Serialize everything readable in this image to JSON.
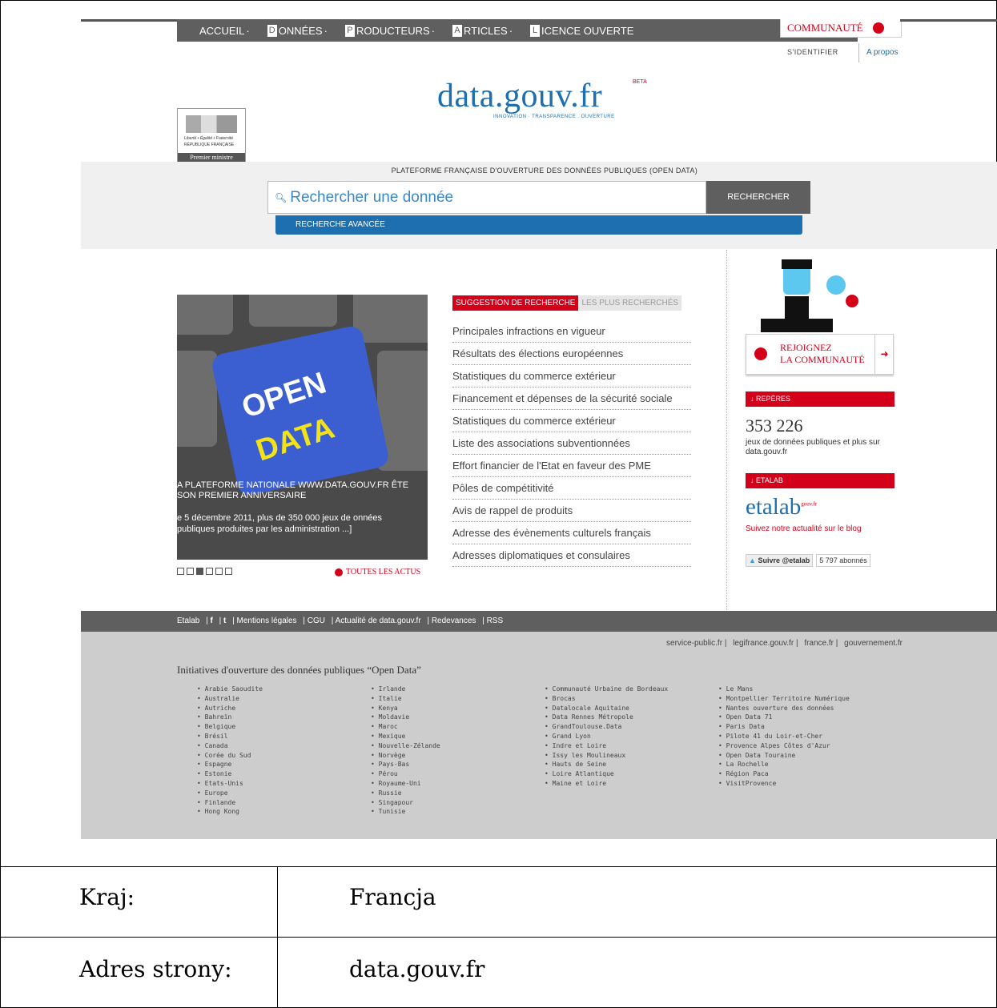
{
  "nav": {
    "items": [
      {
        "letter": "",
        "label": "ACCUEIL"
      },
      {
        "letter": "D",
        "label": "ONNÉES"
      },
      {
        "letter": "P",
        "label": "RODUCTEURS"
      },
      {
        "letter": "A",
        "label": "RTICLES"
      },
      {
        "letter": "L",
        "label": "ICENCE OUVERTE"
      }
    ],
    "community": "COMMUNAUTÉ",
    "login": "S'IDENTIFIER",
    "about": "A propos"
  },
  "header": {
    "logo": "data.gouv.fr",
    "beta": "BETA",
    "tagline": "INNOVATION · TRANSPARENCE . OUVERTURE",
    "rf_motto": "Liberté • Égalité • Fraternité",
    "rf_name": "RÉPUBLIQUE FRANÇAISE",
    "rf_ministry": "Premier ministre"
  },
  "search": {
    "platform": "PLATEFORME FRANÇAISE D'OUVERTURE DES DONNÉES PUBLIQUES (OPEN DATA)",
    "placeholder": "Rechercher une donnée",
    "button": "RECHERCHER",
    "advanced": "RECHERCHE AVANCÉE"
  },
  "carousel": {
    "open": "OPEN",
    "data": "DATA",
    "caption": "A PLATEFORME NATIONALE WWW.DATA.GOUV.FR ÊTE SON PREMIER ANNIVERSAIRE",
    "description": "e 5 décembre 2011, plus de 350 000 jeux de onnées publiques produites par les administration ...]",
    "all_news": "TOUTES LES ACTUS"
  },
  "suggestions": {
    "tab_active": "SUGGESTION DE RECHERCHE",
    "tab_inactive": "LES PLUS RECHERCHÉS",
    "items": [
      "Principales infractions en vigueur",
      "Résultats des élections européennes",
      "Statistiques du commerce extérieur",
      "Financement et dépenses de la sécurité sociale",
      "Statistiques du commerce extérieur",
      "Liste des associations subventionnées",
      "Effort financier de l'Etat en faveur des PME",
      "Pôles de compétitivité",
      "Avis de rappel de produits",
      "Adresse des évènements culturels français",
      "Adresses diplomatiques et consulaires"
    ]
  },
  "sidebar": {
    "join_line1": "REJOIGNEZ",
    "join_line2": "LA COMMUNAUTÉ",
    "reperes": "REPÈRES",
    "count": "353 226",
    "count_text": "jeux de données publiques et plus sur data.gouv.fr",
    "etalab_title": "ETALAB",
    "etalab_logo": "etalab",
    "etalab_sup": "gouv.fr",
    "blog": "Suivez notre actualité sur le blog",
    "follow": "Suivre @etalab",
    "followers": "5 797 abonnés"
  },
  "footer": {
    "links": [
      "Etalab",
      "f",
      "t",
      "Mentions légales",
      "CGU",
      "Actualité de data.gouv.fr",
      "Redevances",
      "RSS"
    ],
    "gov_links": [
      "service-public.fr",
      "legifrance.gouv.fr",
      "france.fr",
      "gouvernement.fr"
    ],
    "initiatives_title": "Initiatives d'ouverture des données publiques “Open Data”",
    "columns": [
      [
        "Arabie Saoudite",
        "Australie",
        "Autriche",
        "Bahreïn",
        "Belgique",
        "Brésil",
        "Canada",
        "Corée du Sud",
        "Espagne",
        "Estonie",
        "Etats-Unis",
        "Europe",
        "Finlande",
        "Hong Kong"
      ],
      [
        "Irlande",
        "Italie",
        "Kenya",
        "Moldavie",
        "Maroc",
        "Mexique",
        "Nouvelle-Zélande",
        "Norvège",
        "Pays-Bas",
        "Pérou",
        "Royaume-Uni",
        "Russie",
        "Singapour",
        "Tunisie"
      ],
      [
        "Communauté Urbaine de Bordeaux",
        "Brocas",
        "Datalocale Aquitaine",
        "Data Rennes Métropole",
        "GrandToulouse.Data",
        "Grand Lyon",
        "Indre et Loire",
        "Issy les Moulineaux",
        "Hauts de Seine",
        "Loire Atlantique",
        "Maine et Loire"
      ],
      [
        "Le Mans",
        "Montpellier Territoire Numérique",
        "Nantes ouverture des données",
        "Open Data 71",
        "Paris Data",
        "Pilote 41 du Loir-et-Cher",
        "Provence Alpes Côtes d'Azur",
        "Open Data Touraine",
        "La Rochelle",
        "Région Paca",
        "VisitProvence"
      ]
    ]
  },
  "table": {
    "country_label": "Kraj:",
    "country_value": "Francja",
    "address_label": "Adres strony:",
    "address_value": "data.gouv.fr"
  },
  "colors": {
    "red": "#d4001a",
    "blue": "#1d6fb0",
    "dark_gray": "#5f5f5f",
    "light_gray": "#cdcdcd"
  }
}
